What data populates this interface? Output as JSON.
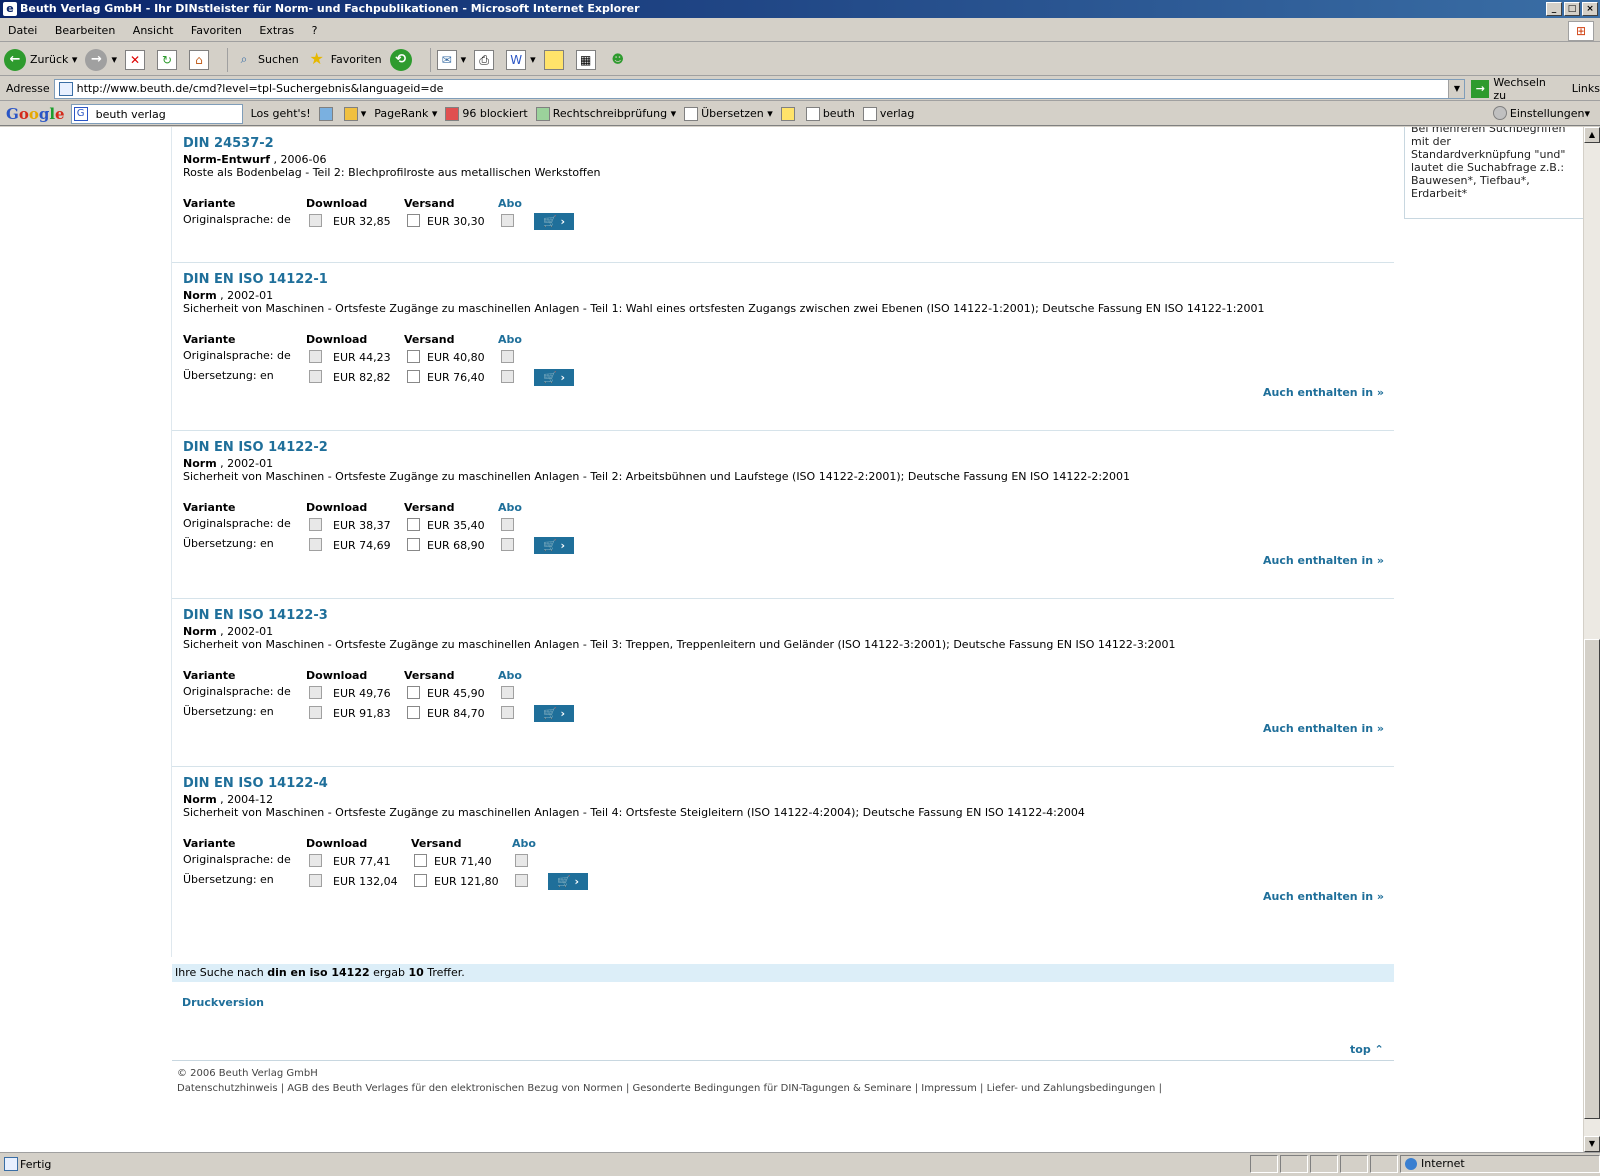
{
  "window": {
    "title": "Beuth Verlag GmbH - Ihr DINstleister für Norm- und Fachpublikationen - Microsoft Internet Explorer"
  },
  "menu": [
    "Datei",
    "Bearbeiten",
    "Ansicht",
    "Favoriten",
    "Extras",
    "?"
  ],
  "toolbar": {
    "back": "Zurück",
    "search": "Suchen",
    "favorites": "Favoriten"
  },
  "address": {
    "label": "Adresse",
    "url": "http://www.beuth.de/cmd?level=tpl-Suchergebnis&languageid=de",
    "go": "Wechseln zu",
    "links": "Links"
  },
  "google": {
    "query": "beuth verlag",
    "los": "Los geht's!",
    "pagerank": "PageRank",
    "blocked": "96 blockiert",
    "spell": "Rechtschreibprüfung",
    "translate": "Übersetzen",
    "term1": "beuth",
    "term2": "verlag",
    "settings": "Einstellungen"
  },
  "sidebox": {
    "text_lines": [
      "Bei mehreren Suchbegriffen",
      "mit der",
      "Standardverknüpfung \"und\"",
      "lautet die Suchabfrage z.B.:",
      "Bauwesen*, Tiefbau*,",
      "Erdarbeit*"
    ]
  },
  "labels": {
    "variante": "Variante",
    "download": "Download",
    "versand": "Versand",
    "abo": "Abo",
    "auch": "Auch enthalten in »",
    "cart": "🛒 ›"
  },
  "entries": [
    {
      "title": "DIN 24537-2",
      "type": "Norm-Entwurf",
      "date": ", 2006-06",
      "desc": "Roste als Bodenbelag - Teil 2: Blechprofilroste aus metallischen Werkstoffen",
      "rows": [
        {
          "label": "Originalsprache: de",
          "download": "EUR 32,85",
          "versand": "EUR 30,30"
        }
      ],
      "auch": false
    },
    {
      "title": "DIN EN ISO 14122-1",
      "type": "Norm",
      "date": ", 2002-01",
      "desc": "Sicherheit von Maschinen - Ortsfeste Zugänge zu maschinellen Anlagen - Teil 1: Wahl eines ortsfesten Zugangs zwischen zwei Ebenen (ISO 14122-1:2001); Deutsche Fassung EN ISO 14122-1:2001",
      "rows": [
        {
          "label": "Originalsprache: de",
          "download": "EUR 44,23",
          "versand": "EUR 40,80"
        },
        {
          "label": "Übersetzung: en",
          "download": "EUR 82,82",
          "versand": "EUR 76,40"
        }
      ],
      "auch": true
    },
    {
      "title": "DIN EN ISO 14122-2",
      "type": "Norm",
      "date": ", 2002-01",
      "desc": "Sicherheit von Maschinen - Ortsfeste Zugänge zu maschinellen Anlagen - Teil 2: Arbeitsbühnen und Laufstege (ISO 14122-2:2001); Deutsche Fassung EN ISO 14122-2:2001",
      "rows": [
        {
          "label": "Originalsprache: de",
          "download": "EUR 38,37",
          "versand": "EUR 35,40"
        },
        {
          "label": "Übersetzung: en",
          "download": "EUR 74,69",
          "versand": "EUR 68,90"
        }
      ],
      "auch": true
    },
    {
      "title": "DIN EN ISO 14122-3",
      "type": "Norm",
      "date": ", 2002-01",
      "desc": "Sicherheit von Maschinen - Ortsfeste Zugänge zu maschinellen Anlagen - Teil 3: Treppen, Treppenleitern und Geländer (ISO 14122-3:2001); Deutsche Fassung EN ISO 14122-3:2001",
      "rows": [
        {
          "label": "Originalsprache: de",
          "download": "EUR 49,76",
          "versand": "EUR 45,90"
        },
        {
          "label": "Übersetzung: en",
          "download": "EUR 91,83",
          "versand": "EUR 84,70"
        }
      ],
      "auch": true
    },
    {
      "title": "DIN EN ISO 14122-4",
      "type": "Norm",
      "date": ", 2004-12",
      "desc": "Sicherheit von Maschinen - Ortsfeste Zugänge zu maschinellen Anlagen - Teil 4: Ortsfeste Steigleitern (ISO 14122-4:2004); Deutsche Fassung EN ISO 14122-4:2004",
      "rows": [
        {
          "label": "Originalsprache: de",
          "download": "EUR 77,41",
          "versand": "EUR 71,40"
        },
        {
          "label": "Übersetzung: en",
          "download": "EUR 132,04",
          "versand": "EUR 121,80"
        }
      ],
      "auch": true
    }
  ],
  "result": {
    "prefix": "Ihre Suche nach",
    "query": "din en iso 14122",
    "mid": "ergab",
    "count": "10",
    "suffix": "Treffer."
  },
  "footer": {
    "druck": "Druckversion",
    "top": "top ⌃",
    "copyright": "© 2006 Beuth Verlag GmbH",
    "links": "Datenschutzhinweis | AGB des Beuth Verlages für den elektronischen Bezug von Normen | Gesonderte Bedingungen für DIN-Tagungen & Seminare | Impressum | Liefer- und Zahlungsbedingungen |"
  },
  "status": {
    "text": "Fertig",
    "zone": "Internet"
  }
}
